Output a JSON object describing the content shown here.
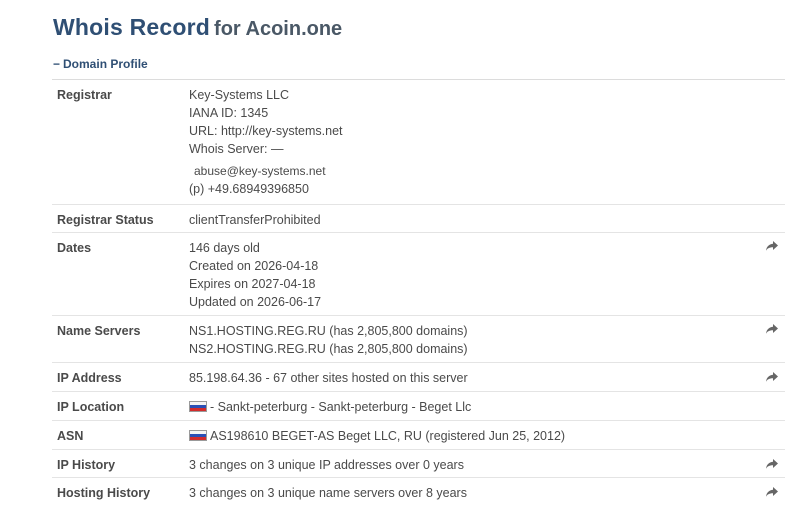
{
  "header": {
    "title": "Whois Record",
    "subtitle": "for Acoin.one"
  },
  "section": {
    "toggle_symbol": "−",
    "label": "Domain Profile"
  },
  "rows": [
    {
      "label": "Registrar",
      "lines": [
        "Key-Systems LLC",
        "IANA ID: 1345",
        "URL: http://key-systems.net",
        "Whois Server: —"
      ],
      "email": "abuse@key-systems.net",
      "phone": "(p) +49.68949396850"
    },
    {
      "label": "Registrar Status",
      "lines": [
        "clientTransferProhibited"
      ]
    },
    {
      "label": "Dates",
      "lines": [
        "146 days old",
        "Created on 2026-04-18",
        "Expires on 2027-04-18",
        "Updated on 2026-06-17"
      ],
      "action_icon": "share-arrow-icon"
    },
    {
      "label": "Name Servers",
      "lines": [
        "NS1.HOSTING.REG.RU (has 2,805,800 domains)",
        "NS2.HOSTING.REG.RU (has 2,805,800 domains)"
      ],
      "action_icon": "share-arrow-icon"
    },
    {
      "label": "IP Address",
      "lines": [
        "85.198.64.36 - 67 other sites hosted on this server"
      ],
      "action_icon": "share-arrow-icon"
    },
    {
      "label": "IP Location",
      "flag": "russia-flag-icon",
      "lines": [
        "- Sankt-peterburg - Sankt-peterburg - Beget Llc"
      ]
    },
    {
      "label": "ASN",
      "flag": "russia-flag-icon",
      "lines": [
        "AS198610 BEGET-AS Beget LLC, RU (registered Jun 25, 2012)"
      ]
    },
    {
      "label": "IP History",
      "lines": [
        "3 changes on 3 unique IP addresses over 0 years"
      ],
      "action_icon": "share-arrow-icon"
    },
    {
      "label": "Hosting History",
      "lines": [
        "3 changes on 3 unique name servers over 8 years"
      ],
      "action_icon": "share-arrow-icon"
    }
  ],
  "colors": {
    "title": "#2f4f74",
    "text": "#4a4a4a",
    "divider": "#e4e4e4",
    "icon": "#666666"
  }
}
